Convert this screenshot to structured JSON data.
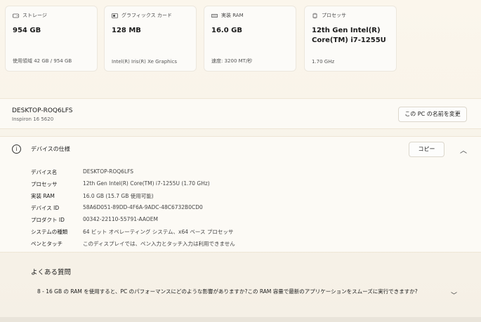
{
  "cards": [
    {
      "icon": "storage-icon",
      "label": "ストレージ",
      "value": "954 GB",
      "sub": "使用領域 42 GB / 954 GB"
    },
    {
      "icon": "graphics-card-icon",
      "label": "グラフィックス カード",
      "value": "128 MB",
      "sub": "Intel(R) Iris(R) Xe Graphics"
    },
    {
      "icon": "ram-icon",
      "label": "実装 RAM",
      "value": "16.0 GB",
      "sub": "速度: 3200 MT/秒"
    },
    {
      "icon": "processor-icon",
      "label": "プロセッサ",
      "value": "12th Gen Intel(R) Core(TM) i7-1255U",
      "sub": "1.70 GHz"
    }
  ],
  "pc": {
    "name": "DESKTOP-ROQ6LFS",
    "model": "Inspiron 16 5620",
    "rename_label": "この PC の名前を変更"
  },
  "specs": {
    "title": "デバイスの仕様",
    "copy_label": "コピー",
    "rows": [
      {
        "key": "デバイス名",
        "value": "DESKTOP-ROQ6LFS"
      },
      {
        "key": "プロセッサ",
        "value": "12th Gen Intel(R) Core(TM) i7-1255U (1.70 GHz)"
      },
      {
        "key": "実装 RAM",
        "value": "16.0 GB (15.7 GB 使用可能)"
      },
      {
        "key": "デバイス ID",
        "value": "58A6D051-89DD-4F6A-9ADC-48C6732B0CD0"
      },
      {
        "key": "プロダクト ID",
        "value": "00342-22110-55791-AAOEM"
      },
      {
        "key": "システムの種類",
        "value": "64 ビット オペレーティング システム、x64 ベース プロセッサ"
      },
      {
        "key": "ペンとタッチ",
        "value": "このディスプレイでは、ペン入力とタッチ入力は利用できません"
      }
    ]
  },
  "faq": {
    "title": "よくある質問",
    "question": "8 - 16 GB の RAM を使用すると、PC のパフォーマンスにどのような影響がありますか?この RAM 容量で最新のアプリケーションをスムーズに実行できますか?"
  },
  "colors": {
    "background": "#fbf6ec",
    "card": "#fcfbf8",
    "border": "#ece7dd"
  }
}
